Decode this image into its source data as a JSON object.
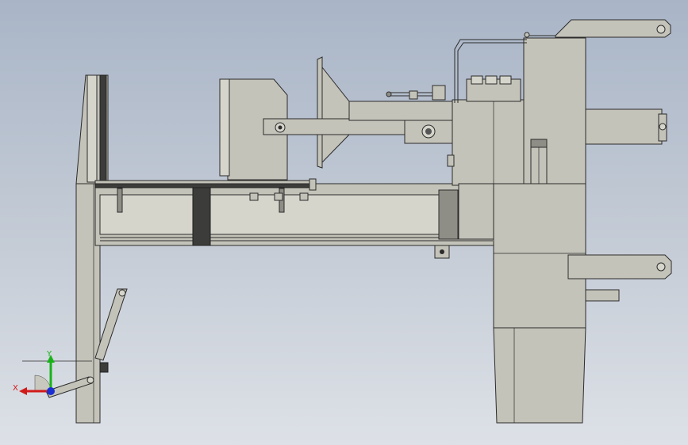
{
  "viewport": {
    "background_top": "#a9b5c7",
    "background_bottom": "#dde1e7",
    "part_color": "#c4c3b9"
  },
  "triad": {
    "x_label": "X",
    "y_label": "Y",
    "x_color": "#d11a1a",
    "y_color": "#19b319",
    "z_color": "#1a2fd1"
  }
}
